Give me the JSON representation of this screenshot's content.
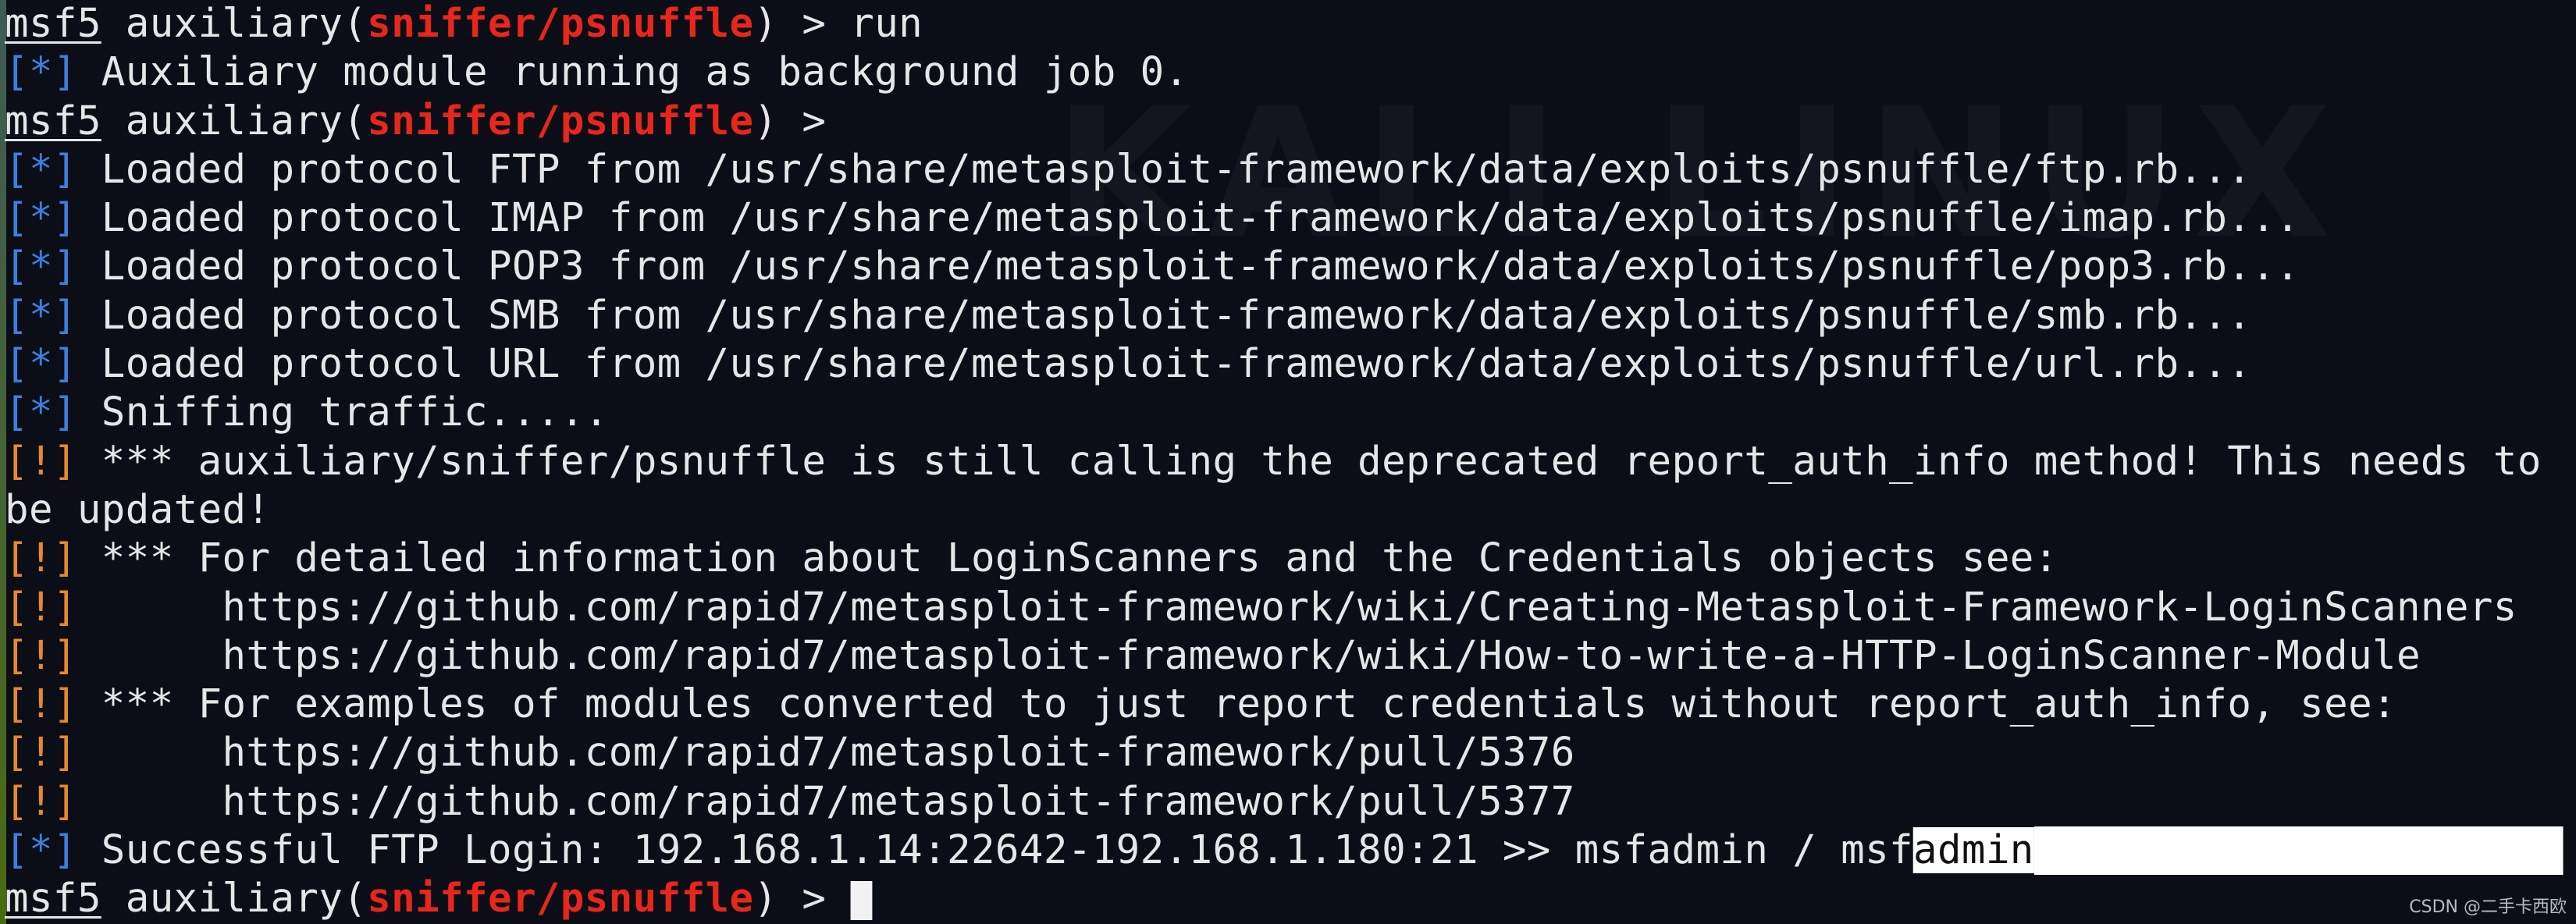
{
  "terminal": {
    "background_color": "#0b0e16",
    "colors": {
      "info": "#3d7fe0",
      "warning": "#e58a2a",
      "module": "#e8261c",
      "text": "#e6e6e6"
    },
    "lines": [
      [
        {
          "t": "msf5",
          "c": "prompt-msf"
        },
        {
          "t": " auxiliary("
        },
        {
          "t": "sniffer/psnuffle",
          "c": "mod"
        },
        {
          "t": ") > run"
        }
      ],
      [
        {
          "t": "[*]",
          "c": "info"
        },
        {
          "t": " Auxiliary module running as background job 0."
        }
      ],
      [
        {
          "t": "msf5",
          "c": "prompt-msf"
        },
        {
          "t": " auxiliary("
        },
        {
          "t": "sniffer/psnuffle",
          "c": "mod"
        },
        {
          "t": ") >"
        }
      ],
      [
        {
          "t": "[*]",
          "c": "info"
        },
        {
          "t": " Loaded protocol FTP from /usr/share/metasploit-framework/data/exploits/psnuffle/ftp.rb..."
        }
      ],
      [
        {
          "t": "[*]",
          "c": "info"
        },
        {
          "t": " Loaded protocol IMAP from /usr/share/metasploit-framework/data/exploits/psnuffle/imap.rb..."
        }
      ],
      [
        {
          "t": "[*]",
          "c": "info"
        },
        {
          "t": " Loaded protocol POP3 from /usr/share/metasploit-framework/data/exploits/psnuffle/pop3.rb..."
        }
      ],
      [
        {
          "t": "[*]",
          "c": "info"
        },
        {
          "t": " Loaded protocol SMB from /usr/share/metasploit-framework/data/exploits/psnuffle/smb.rb..."
        }
      ],
      [
        {
          "t": "[*]",
          "c": "info"
        },
        {
          "t": " Loaded protocol URL from /usr/share/metasploit-framework/data/exploits/psnuffle/url.rb..."
        }
      ],
      [
        {
          "t": "[*]",
          "c": "info"
        },
        {
          "t": " Sniffing traffic....."
        }
      ],
      [
        {
          "t": "[!]",
          "c": "warn"
        },
        {
          "t": " *** auxiliary/sniffer/psnuffle is still calling the deprecated report_auth_info method! This needs to"
        }
      ],
      [
        {
          "t": "be updated!"
        }
      ],
      [
        {
          "t": "[!]",
          "c": "warn"
        },
        {
          "t": " *** For detailed information about LoginScanners and the Credentials objects see:"
        }
      ],
      [
        {
          "t": "[!]",
          "c": "warn"
        },
        {
          "t": "      https://github.com/rapid7/metasploit-framework/wiki/Creating-Metasploit-Framework-LoginScanners"
        }
      ],
      [
        {
          "t": "[!]",
          "c": "warn"
        },
        {
          "t": "      https://github.com/rapid7/metasploit-framework/wiki/How-to-write-a-HTTP-LoginScanner-Module"
        }
      ],
      [
        {
          "t": "[!]",
          "c": "warn"
        },
        {
          "t": " *** For examples of modules converted to just report credentials without report_auth_info, see:"
        }
      ],
      [
        {
          "t": "[!]",
          "c": "warn"
        },
        {
          "t": "      https://github.com/rapid7/metasploit-framework/pull/5376"
        }
      ],
      [
        {
          "t": "[!]",
          "c": "warn"
        },
        {
          "t": "      https://github.com/rapid7/metasploit-framework/pull/5377"
        }
      ],
      [
        {
          "t": "[*]",
          "c": "info"
        },
        {
          "t": " Successful FTP Login: 192.168.1.14:22642-192.168.1.180:21 >> msfadmin / msf"
        },
        {
          "t": "admin",
          "c": "sel"
        },
        {
          "fill": true
        }
      ],
      [
        {
          "t": "msf5",
          "c": "prompt-msf"
        },
        {
          "t": " auxiliary("
        },
        {
          "t": "sniffer/psnuffle",
          "c": "mod"
        },
        {
          "t": ") > "
        },
        {
          "cursor": true
        }
      ]
    ]
  },
  "background_logo": "KALI LINUX",
  "watermark": "CSDN @二手卡西欧"
}
